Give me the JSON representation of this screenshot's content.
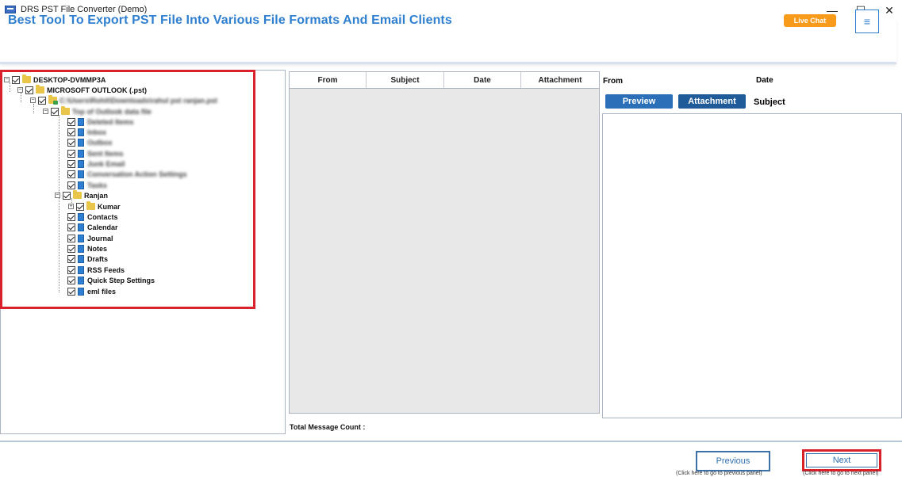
{
  "window": {
    "title": "DRS PST File Converter (Demo)",
    "minimize_glyph": "—",
    "maximize_glyph": "☐",
    "close_glyph": "✕"
  },
  "header": {
    "title": "Best Tool To Export PST File Into Various File Formats And Email Clients",
    "live_chat_label": "Live Chat",
    "menu_glyph": "≡"
  },
  "tree": {
    "items": [
      {
        "label": "DESKTOP-DVMMP3A",
        "expander": "−",
        "icon": "computer-icon"
      },
      {
        "label": "MICROSOFT OUTLOOK (.pst)",
        "expander": "−",
        "icon": "outlook-icon"
      },
      {
        "label": "C:\\Users\\Rohit\\Downloads\\rahul pst ranjan.pst",
        "expander": "−",
        "icon": "pst-file-icon"
      },
      {
        "label": "Top of Outlook data file",
        "expander": "−",
        "icon": "folder-icon"
      },
      {
        "label": "Deleted Items",
        "icon": "folder-icon"
      },
      {
        "label": "Inbox",
        "icon": "folder-icon"
      },
      {
        "label": "Outbox",
        "icon": "folder-icon"
      },
      {
        "label": "Sent Items",
        "icon": "folder-icon"
      },
      {
        "label": "Junk Email",
        "icon": "folder-icon"
      },
      {
        "label": "Conversation Action Settings",
        "icon": "folder-icon"
      },
      {
        "label": "Tasks",
        "icon": "folder-icon"
      },
      {
        "label": "Ranjan",
        "expander": "−",
        "icon": "folder-icon"
      },
      {
        "label": "Kumar",
        "expander": "+",
        "icon": "folder-icon"
      },
      {
        "label": "Contacts",
        "icon": "folder-icon"
      },
      {
        "label": "Calendar",
        "icon": "folder-icon"
      },
      {
        "label": "Journal",
        "icon": "folder-icon"
      },
      {
        "label": "Notes",
        "icon": "folder-icon"
      },
      {
        "label": "Drafts",
        "icon": "folder-icon"
      },
      {
        "label": "RSS Feeds",
        "icon": "folder-icon"
      },
      {
        "label": "Quick Step Settings",
        "icon": "folder-icon"
      },
      {
        "label": "eml files",
        "icon": "folder-icon"
      }
    ]
  },
  "message_list": {
    "columns": [
      "From",
      "Subject",
      "Date",
      "Attachment"
    ],
    "total_label": "Total Message Count :"
  },
  "preview": {
    "from_label": "From",
    "date_label": "Date",
    "subject_label": "Subject",
    "preview_button": "Preview",
    "attachment_button": "Attachment"
  },
  "footer": {
    "previous_label": "Previous",
    "next_label": "Next",
    "previous_hint": "(Click here to go to previous panel)",
    "next_hint": "(Click here to go to next panel)"
  },
  "colors": {
    "accent": "#2f7fd0",
    "live_chat": "#f89a1a",
    "highlight_red": "#d8212a",
    "preview_button": "#2a6fb7",
    "attachment_button": "#1f5a99"
  }
}
